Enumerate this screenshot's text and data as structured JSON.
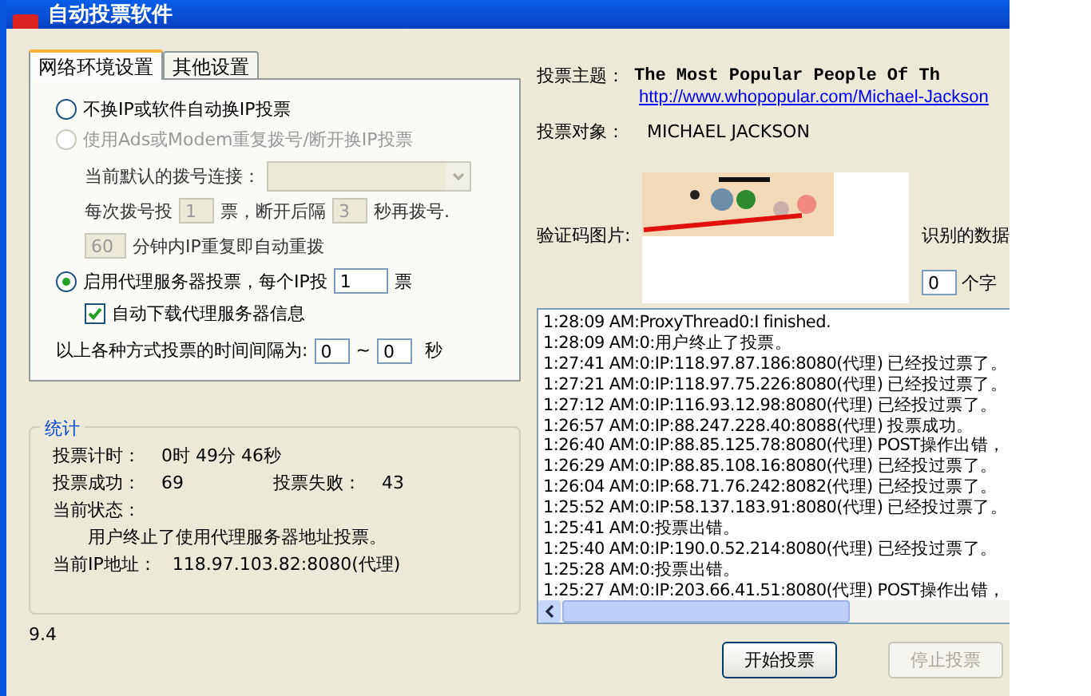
{
  "window": {
    "title": "自动投票软件"
  },
  "tabs": [
    {
      "label": "网络环境设置",
      "selected": true
    },
    {
      "label": "其他设置",
      "selected": false
    }
  ],
  "modes": [
    {
      "kind": "radio",
      "label": "不换IP或软件自动换IP投票",
      "selected": false,
      "disabled": false
    },
    {
      "kind": "radio",
      "label": "使用Ads或Modem重复拨号/断开换IP投票",
      "selected": false,
      "disabled": true
    }
  ],
  "dial": {
    "disabled": true,
    "connection_label": "当前默认的拨号连接：",
    "per_dial_label": "每次拨号投",
    "per_dial_value": "1",
    "per_dial_unit": "票，断开后隔",
    "wait_value": "3",
    "wait_unit": "秒再拨号.",
    "repeat_value": "60",
    "repeat_label": "分钟内IP重复即自动重拨"
  },
  "proxy": {
    "label": "启用代理服务器投票，每个IP投",
    "selected": true,
    "votes": "1",
    "unit": "票",
    "auto_download": {
      "label": "自动下载代理服务器信息",
      "checked": true
    }
  },
  "interval": {
    "label": "以上各种方式投票的时间间隔为:",
    "min": "0",
    "separator": "~",
    "max": "0",
    "unit": "秒"
  },
  "stats": {
    "title": "统计",
    "timer_label": "投票计时：",
    "timer": "0时 49分 46秒",
    "success_label": "投票成功：",
    "success": "69",
    "fail_label": "投票失败：",
    "fail": "43",
    "status_label": "当前状态：",
    "status": "用户终止了使用代理服务器地址投票。",
    "ip_label": "当前IP地址：",
    "ip": "118.97.103.82:8080(代理)"
  },
  "version": "9.4",
  "topic": {
    "label": "投票主题：",
    "title": "The Most Popular People Of Th",
    "url": "http://www.whopopular.com/Michael-Jackson"
  },
  "target": {
    "label": "投票对象：",
    "value": "MICHAEL JACKSON"
  },
  "captcha": {
    "label": "验证码图片:",
    "recognized_label": "识别的数据",
    "count": "0",
    "count_unit": "个字"
  },
  "log": [
    "1:28:09 AM:ProxyThread0:I finished.",
    "1:28:09 AM:0:用户终止了投票。",
    "1:27:41 AM:0:IP:118.97.87.186:8080(代理) 已经投过票了。",
    "1:27:21 AM:0:IP:118.97.75.226:8080(代理) 已经投过票了。",
    "1:27:12 AM:0:IP:116.93.12.98:8080(代理) 已经投过票了。",
    "1:26:57 AM:0:IP:88.247.228.40:8088(代理) 投票成功。",
    "1:26:40 AM:0:IP:88.85.125.78:8080(代理) POST操作出错，",
    "1:26:29 AM:0:IP:88.85.108.16:8080(代理) 已经投过票了。",
    "1:26:04 AM:0:IP:68.71.76.242:8082(代理) 已经投过票了。",
    "1:25:52 AM:0:IP:58.137.183.91:8080(代理) 已经投过票了。",
    "1:25:41 AM:0:投票出错。",
    "1:25:40 AM:0:IP:190.0.52.214:8080(代理) 已经投过票了。",
    "1:25:28 AM:0:投票出错。",
    "1:25:27 AM:0:IP:203.66.41.51:8080(代理) POST操作出错，"
  ],
  "buttons": [
    {
      "label": "开始投票",
      "disabled": false
    },
    {
      "label": "停止投票",
      "disabled": true
    }
  ]
}
